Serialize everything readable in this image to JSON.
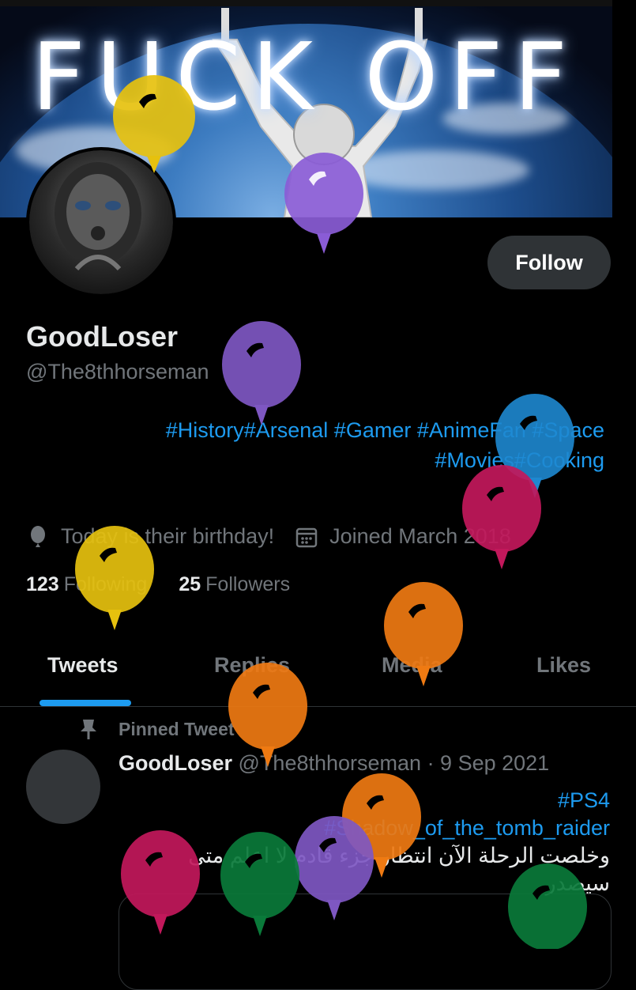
{
  "banner": {
    "text": "FUCK OFF"
  },
  "profile": {
    "name": "GoodLoser",
    "handle": "@The8thhorseman",
    "follow_label": "Follow",
    "bio_line1": "#History#Arsenal #Gamer #AnimeFan #Space",
    "bio_line2": "#Movies#Cooking",
    "birthday": "Today is their birthday!",
    "joined": "Joined March 2018",
    "following_count": "123",
    "following_label": "Following",
    "followers_count": "25",
    "followers_label": "Followers"
  },
  "tabs": [
    {
      "label": "Tweets",
      "active": true
    },
    {
      "label": "Replies"
    },
    {
      "label": "Media"
    },
    {
      "label": "Likes"
    }
  ],
  "pinned": {
    "label": "Pinned Tweet",
    "author": "GoodLoser",
    "handle_date": "@The8thhorseman · 9 Sep 2021",
    "tag1": "#PS4",
    "tag2": "#Shadow_of_the_tomb_raider",
    "text": "وخلصت الرحلة الآن انتظار جزء قادم لا اعلم متى سيصدر"
  },
  "colors": {
    "accent": "#1d9bf0",
    "balloon_yellow": "#e6c10e",
    "balloon_purple": "#7e57c2",
    "balloon_blue": "#1e88d0",
    "balloon_pink": "#c2185b",
    "balloon_orange": "#ef7a12",
    "balloon_green": "#0a7a3a"
  },
  "icons": [
    "balloon-icon",
    "calendar-icon",
    "pin-icon"
  ]
}
